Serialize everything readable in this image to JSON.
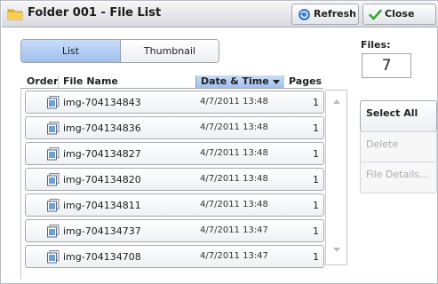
{
  "window": {
    "title": "Folder 001 - File List"
  },
  "toolbar": {
    "refresh_label": "Refresh",
    "close_label": "Close"
  },
  "view_tabs": {
    "list_label": "List",
    "thumbnail_label": "Thumbnail",
    "selected": "List"
  },
  "files": {
    "label": "Files:",
    "count": "7"
  },
  "table": {
    "headers": {
      "order": "Order",
      "file_name": "File Name",
      "date_time": "Date & Time",
      "pages": "Pages"
    },
    "sorted_by": "Date & Time",
    "rows": [
      {
        "name": "img-704134843",
        "date": "4/7/2011 13:48",
        "pages": "1"
      },
      {
        "name": "img-704134836",
        "date": "4/7/2011 13:48",
        "pages": "1"
      },
      {
        "name": "img-704134827",
        "date": "4/7/2011 13:48",
        "pages": "1"
      },
      {
        "name": "img-704134820",
        "date": "4/7/2011 13:48",
        "pages": "1"
      },
      {
        "name": "img-704134811",
        "date": "4/7/2011 13:48",
        "pages": "1"
      },
      {
        "name": "img-704134737",
        "date": "4/7/2011 13:47",
        "pages": "1"
      },
      {
        "name": "img-704134708",
        "date": "4/7/2011 13:47",
        "pages": "1"
      }
    ]
  },
  "side_buttons": {
    "select_all": "Select All",
    "delete": "Delete",
    "file_details": "File Details..."
  },
  "colors": {
    "accent_selected": "#9fc0ee",
    "refresh_icon": "#3a7fd5",
    "close_check": "#3aa335",
    "folder_icon": "#f2b731"
  },
  "icons": {
    "title": "folder-icon",
    "refresh": "refresh-icon",
    "close": "checkmark-icon",
    "row": "image-file-icon",
    "sort": "sort-descending-icon"
  }
}
